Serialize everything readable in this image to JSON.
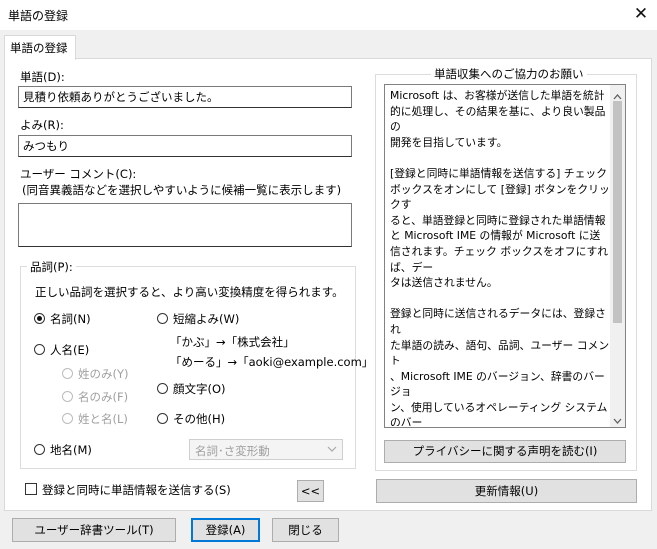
{
  "window": {
    "title": "単語の登録",
    "close_glyph": "✕"
  },
  "tab": {
    "label": "単語の登録"
  },
  "word": {
    "label": "単語(D):",
    "value": "見積り依頼ありがとうございました。"
  },
  "reading": {
    "label": "よみ(R):",
    "value": "みつもり"
  },
  "comment": {
    "label": "ユーザー コメント(C):",
    "hint": "(同音異義語などを選択しやすいように候補一覧に表示します)",
    "value": ""
  },
  "pos": {
    "group_label": "品詞(P):",
    "description": "正しい品詞を選択すると、より高い変換精度を得られます。",
    "noun": "名詞(N)",
    "person": "人名(E)",
    "surname": "姓のみ(Y)",
    "given": "名のみ(F)",
    "both": "姓と名(L)",
    "place": "地名(M)",
    "short": "短縮よみ(W)",
    "short_ex1": "「かぶ」→「株式会社」",
    "short_ex2": "「めーる」→「aoki@example.com」",
    "emoticon": "顔文字(O)",
    "other": "その他(H)",
    "select_value": "名詞･さ変形動",
    "selected": "noun"
  },
  "send": {
    "checkbox_label": "登録と同時に単語情報を送信する(S)",
    "checked": false
  },
  "toggle_button": "<<",
  "cooperation": {
    "group_label": "単語収集へのご協力のお願い",
    "text": "Microsoft は、お客様が送信した単語を統計\n的に処理し、その結果を基に、より良い製品の\n開発を目指しています。\n\n[登録と同時に単語情報を送信する] チェック\nボックスをオンにして [登録] ボタンをクリックす\nると、単語登録と同時に登録された単語情報\nと Microsoft IME の情報が Microsoft に送\n信されます。チェック ボックスをオフにすれば、デー\nタは送信されません。\n\n登録と同時に送信されるデータには、登録され\nた単語の読み、語句、品詞、ユーザー コメント\n、Microsoft IME のバージョン、辞書のバージョ\nン、使用しているオペレーティング システムのバー\nジョンおよびコンピューター ハードウェアの情報、\nコンピューターのインターネット プロトコル (IP) ア\nドレスが含まれます。\n\nお客様特有の情報が収集されたデータに含ま\nれることがあります。このような情報が存在する\n場合でも、Microsoft では、お客様を特定す\nるために使用することはありません。",
    "privacy_button": "プライバシーに関する声明を読む(I)"
  },
  "update_button": "更新情報(U)",
  "footer": {
    "dict_tool": "ユーザー辞書ツール(T)",
    "register": "登録(A)",
    "close": "閉じる"
  }
}
